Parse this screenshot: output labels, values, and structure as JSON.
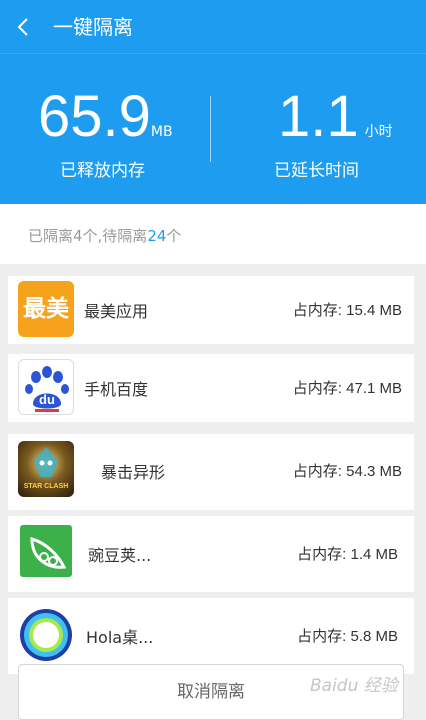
{
  "header": {
    "title": "一键隔离",
    "back_icon": "chevron-left-icon",
    "bg_color": "#1e9cf0",
    "memory": {
      "value": "65.9",
      "unit": "MB",
      "label": "已释放内存"
    },
    "time": {
      "value": "1.1",
      "unit": "小时",
      "label": "已延长时间"
    }
  },
  "summary": {
    "prefix": "已隔离4个,待隔离",
    "pending": "24",
    "suffix": "个",
    "highlight_color": "#1e9cf0"
  },
  "apps": [
    {
      "name": "最美应用",
      "memory": "占内存: 15.4 MB",
      "icon": "zuimei-app-icon",
      "icon_text": "最美"
    },
    {
      "name": "手机百度",
      "memory": "占内存: 47.1 MB",
      "icon": "baidu-app-icon",
      "icon_text": "du"
    },
    {
      "name": "暴击异形",
      "memory": "占内存: 54.3 MB",
      "icon": "game-app-icon",
      "icon_text": "STAR CLASH"
    },
    {
      "name": "豌豆荚...",
      "memory": "占内存: 1.4 MB",
      "icon": "wandoujia-app-icon"
    },
    {
      "name": "Hola桌...",
      "memory": "占内存: 5.8 MB",
      "icon": "hola-launcher-icon"
    }
  ],
  "footer": {
    "cancel_label": "取消隔离",
    "watermark": "Baidu 经验"
  }
}
